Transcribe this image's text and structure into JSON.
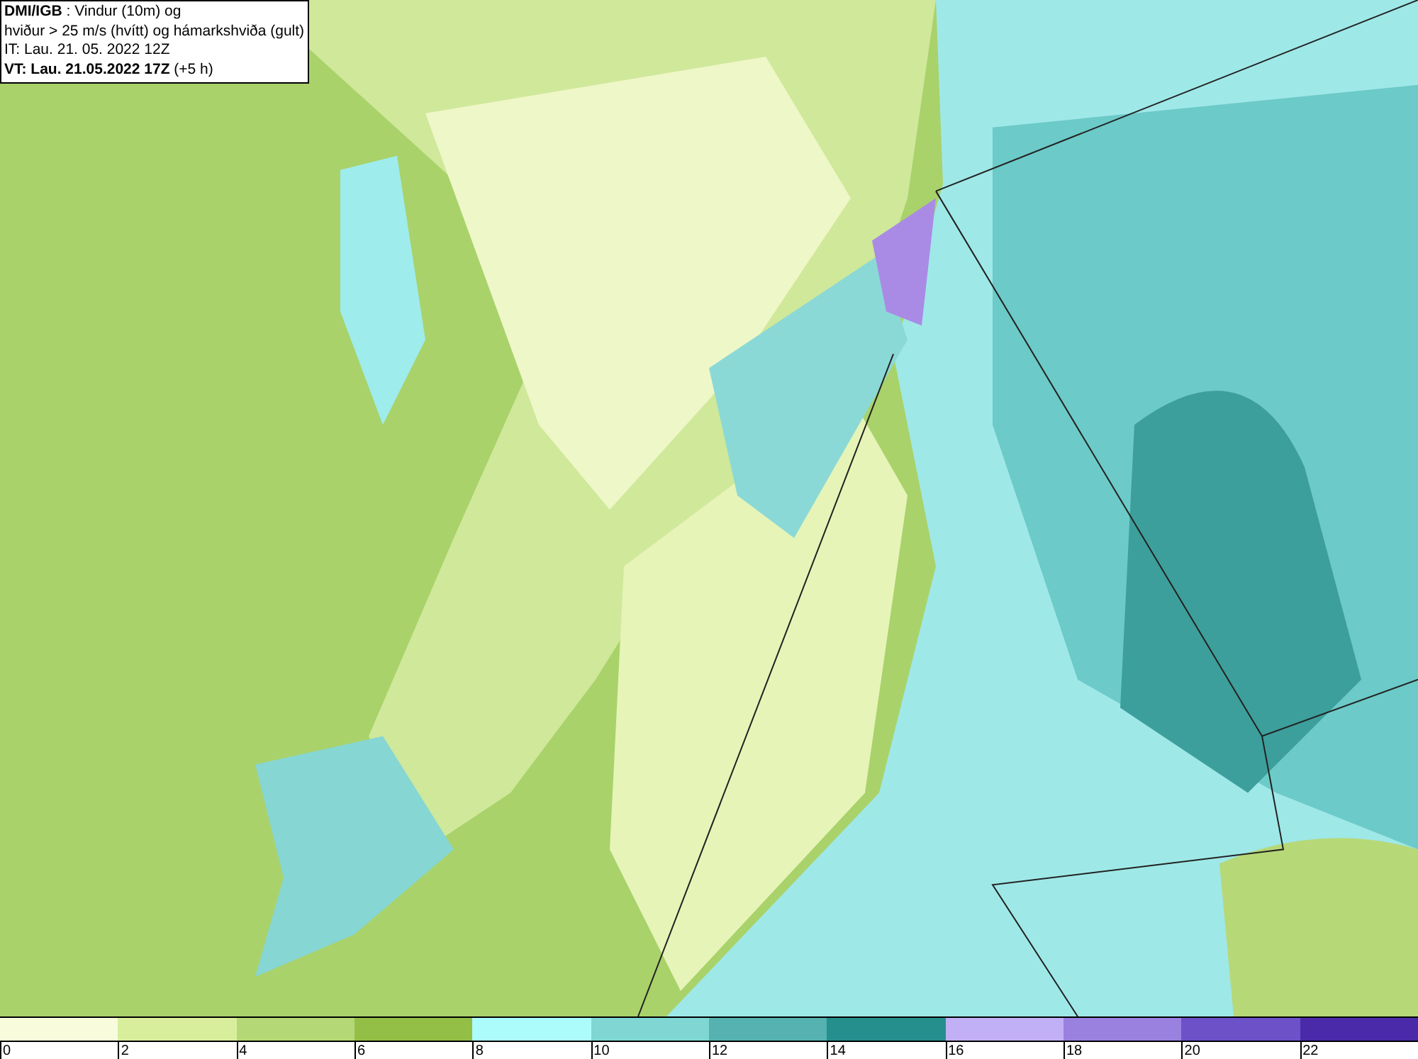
{
  "title_box": {
    "lines": [
      "**DMI/IGB** : Vindur (10m) og",
      "hviður > 25 m/s (hvítt) og hámarkshviða (gult)",
      "IT: Lau. 21. 05. 2022 12Z",
      "**VT: Lau. 21.05.2022 17Z** (+5 h)"
    ]
  },
  "legend": {
    "bins": [
      {
        "label": "0",
        "color": "#f8fcdc"
      },
      {
        "label": "2",
        "color": "#d9ee9c"
      },
      {
        "label": "4",
        "color": "#b4d875"
      },
      {
        "label": "6",
        "color": "#94bf46"
      },
      {
        "label": "8",
        "color": "#acfcfc"
      },
      {
        "label": "10",
        "color": "#7fd6d2"
      },
      {
        "label": "12",
        "color": "#55b2b0"
      },
      {
        "label": "14",
        "color": "#258f8d"
      },
      {
        "label": "16",
        "color": "#c2b0f7"
      },
      {
        "label": "18",
        "color": "#9a81e0"
      },
      {
        "label": "20",
        "color": "#6d51c9"
      },
      {
        "label": "22",
        "color": "#4a2aa8"
      }
    ]
  }
}
